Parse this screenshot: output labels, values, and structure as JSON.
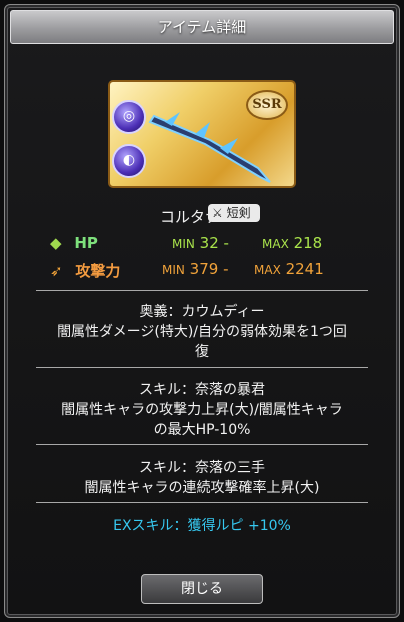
{
  "dialog": {
    "title": "アイテム詳細"
  },
  "card": {
    "rarity": "SSR",
    "orb_top": "◎",
    "orb_bottom": "◐"
  },
  "weapon": {
    "name": "コルタナ",
    "type": "短剣"
  },
  "stats": {
    "hp": {
      "label": "HP",
      "min_label": "MIN",
      "min": "32",
      "sep": "-",
      "max_label": "MAX",
      "max": "218"
    },
    "atk": {
      "label": "攻撃力",
      "min_label": "MIN",
      "min": "379",
      "sep": "-",
      "max_label": "MAX",
      "max": "2241"
    }
  },
  "skills": {
    "ougi_title": "奥義：カウムディー",
    "ougi_line1": "闇属性ダメージ(特大)/自分の弱体効果を1つ回",
    "ougi_line2": "復",
    "skill1_title": "スキル：奈落の暴君",
    "skill1_line1": "闇属性キャラの攻撃力上昇(大)/闇属性キャラ",
    "skill1_line2": "の最大HP-10%",
    "skill2_title": "スキル：奈落の三手",
    "skill2_line1": "闇属性キャラの連続攻撃確率上昇(大)",
    "ex_skill": "EXスキル：獲得ルピ +10%"
  },
  "buttons": {
    "close": "閉じる"
  }
}
